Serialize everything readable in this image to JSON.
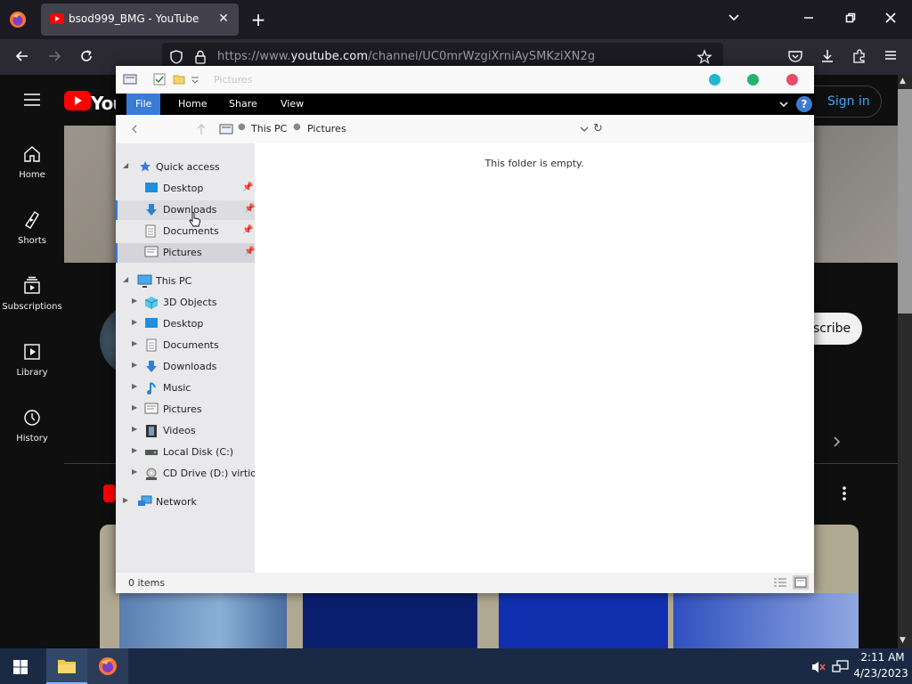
{
  "browser": {
    "tab_title": "bsod999_BMG - YouTube",
    "tab_close": "✕",
    "new_tab": "+",
    "url_prefix": "https://www.",
    "url_domain": "youtube.com",
    "url_path": "/channel/UC0mrWzgiXrniAySMKziXN2g"
  },
  "youtube": {
    "logo_text": "You",
    "sidebar": [
      {
        "label": "Home",
        "icon": "home-icon"
      },
      {
        "label": "Shorts",
        "icon": "shorts-icon"
      },
      {
        "label": "Subscriptions",
        "icon": "subscriptions-icon"
      },
      {
        "label": "Library",
        "icon": "library-icon"
      },
      {
        "label": "History",
        "icon": "history-icon"
      }
    ],
    "sign_in_label": "Sign in",
    "subscribe_label": "scribe"
  },
  "explorer": {
    "title": "Pictures",
    "ribbon_tabs": [
      "File",
      "Home",
      "Share",
      "View"
    ],
    "breadcrumb": [
      "This PC",
      "Pictures"
    ],
    "nav": {
      "quick_access": "Quick access",
      "quick_items": [
        "Desktop",
        "Downloads",
        "Documents",
        "Pictures"
      ],
      "this_pc": "This PC",
      "pc_items": [
        "3D Objects",
        "Desktop",
        "Documents",
        "Downloads",
        "Music",
        "Pictures",
        "Videos",
        "Local Disk (C:)",
        "CD Drive (D:) virtio-"
      ],
      "network": "Network"
    },
    "empty_message": "This folder is empty.",
    "status": "0 items"
  },
  "taskbar": {
    "time": "2:11 AM",
    "date": "4/23/2023"
  },
  "colors": {
    "accent": "#3a7bd5",
    "yt_red": "#ff0000",
    "traffic_teal": "#1fb6d0",
    "traffic_green": "#26b36c",
    "traffic_red": "#e84a6a"
  }
}
